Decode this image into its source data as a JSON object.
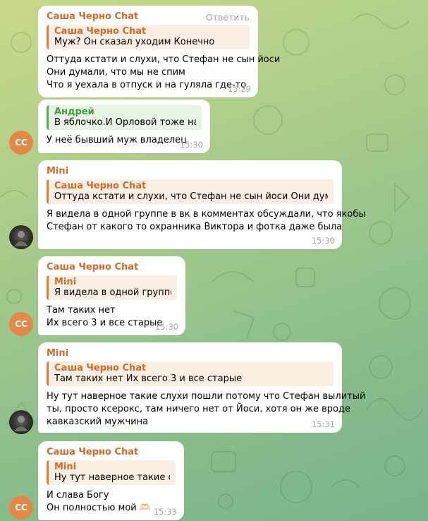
{
  "messages": [
    {
      "sender": "Саша Черно Chat",
      "reply_action": "Ответить",
      "reply": {
        "name": "Саша Черно Chat",
        "text": "Муж? Он сказал уходим Конечно"
      },
      "lines": [
        "Оттуда кстати и слухи, что Стефан не сын йоси",
        "Они думали, что мы не спим",
        "Что я уехала в отпуск и на гуляла где-то"
      ],
      "time": "15:29"
    },
    {
      "reply": {
        "name": "Андрей",
        "text": "В яблочко.И Орловой тоже на..."
      },
      "lines": [
        "У неё бывший муж владелец"
      ],
      "time": "15:30",
      "avatar": "СС"
    },
    {
      "sender": "Mini",
      "reply": {
        "name": "Саша Черно Chat",
        "text": "Оттуда кстати и слухи, что Стефан не сын йоси  Они думали, ..."
      },
      "lines": [
        "Я видела в одной группе в вк в комментах обсуждали, что якобы",
        "Стефан от какого то охранника Виктора и фотка даже была"
      ],
      "time": "15:30"
    },
    {
      "sender": "Саша Черно Chat",
      "reply": {
        "name": "Mini",
        "text": "Я видела в одной группе ..."
      },
      "lines": [
        "Там таких нет",
        "Их всего 3 и все старые"
      ],
      "time": "15:30",
      "avatar": "СС"
    },
    {
      "sender": "Mini",
      "reply": {
        "name": "Саша Черно Chat",
        "text": "Там таких нет Их всего 3 и все старые"
      },
      "lines": [
        "Ну тут наверное такие слухи пошли потому что Стефан вылитый",
        "ты, просто ксерокс, там ничего нет от Йоси, хотя он же вроде",
        "кавказский мужчина"
      ],
      "time": "15:31"
    },
    {
      "sender": "Саша Черно Chat",
      "reply": {
        "name": "Mini",
        "text": "Ну тут наверное такие сл..."
      },
      "lines": [
        "И слава Богу",
        "Он полностью мой 🫶🏻"
      ],
      "time": "15:33",
      "avatar": "СС"
    }
  ],
  "colors": {
    "sender_orange": "#d26a2a",
    "sender_green": "#3d9a3c",
    "avatar_cc": "#e2894a",
    "time": "#a0a7ad"
  }
}
